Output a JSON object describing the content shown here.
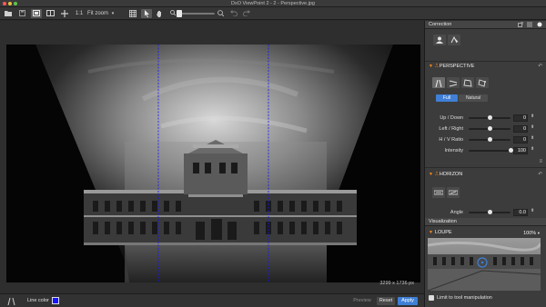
{
  "window": {
    "title": "DxO ViewPoint 2 - 2 - Perspective.jpg"
  },
  "toolbar": {
    "zoom_1to1_label": "1:1",
    "fit_zoom_label": "Fit zoom",
    "fit_zoom_arrow": "▾"
  },
  "viewer": {
    "dimensions": "3299 x 1736 px"
  },
  "bottombar": {
    "line_color_label": "Line color",
    "line_color_value": "#1515ff",
    "preview_label": "Preview",
    "reset_label": "Reset",
    "apply_label": "Apply"
  },
  "panel": {
    "correction_header": "Correction",
    "perspective": {
      "header": "PERSPECTIVE",
      "full_label": "Full",
      "natural_label": "Natural",
      "sliders": [
        {
          "label": "Up / Down",
          "value": "0",
          "position": 0.5
        },
        {
          "label": "Left / Right",
          "value": "0",
          "position": 0.5
        },
        {
          "label": "H / V Ratio",
          "value": "0",
          "position": 0.5
        },
        {
          "label": "Intensity",
          "value": "100",
          "position": 1.0
        }
      ]
    },
    "horizon": {
      "header": "HORIZON",
      "angle_label": "Angle",
      "angle_value": "0.0",
      "angle_position": 0.5
    },
    "visualization_header": "Visualization",
    "loupe": {
      "header": "LOUPE",
      "zoom_value": "100%",
      "limit_label": "Limit to tool manipulation"
    }
  },
  "colors": {
    "accent_orange": "#ff8a1c",
    "selected_blue": "#3f7fd6",
    "guide_line": "#1515ff"
  }
}
